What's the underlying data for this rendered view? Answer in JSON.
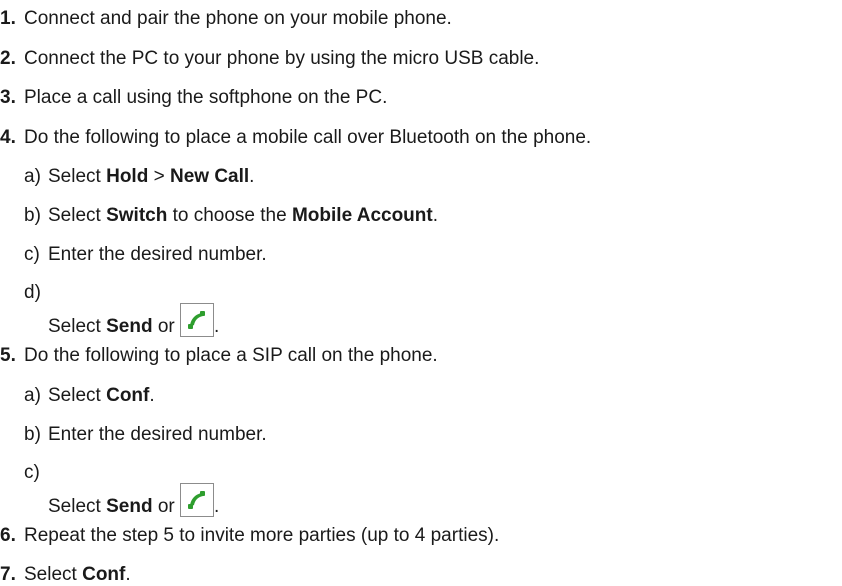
{
  "steps": [
    {
      "num": "1.",
      "text": "Connect and pair the phone on your mobile phone."
    },
    {
      "num": "2.",
      "text": "Connect the PC to your phone by using the micro USB cable."
    },
    {
      "num": "3.",
      "text": "Place a call using the softphone on the PC."
    },
    {
      "num": "4.",
      "text": "Do the following to place a mobile call over Bluetooth on the phone.",
      "substeps": {
        "a": {
          "letter": "a)",
          "pre": "Select ",
          "b1": "Hold",
          "mid": " > ",
          "b2": "New Call",
          "post": "."
        },
        "b": {
          "letter": "b)",
          "pre": "Select ",
          "b1": "Switch",
          "mid": " to choose the ",
          "b2": "Mobile Account",
          "post": "."
        },
        "c": {
          "letter": "c)",
          "text": "Enter the desired number."
        },
        "d": {
          "letter": "d)",
          "pre": "Select ",
          "b1": "Send",
          "mid": " or ",
          "post": "."
        }
      }
    },
    {
      "num": "5.",
      "text": "Do the following to place a SIP call on the phone.",
      "substeps": {
        "a": {
          "letter": "a)",
          "pre": "Select ",
          "b1": "Conf",
          "post": "."
        },
        "b": {
          "letter": "b)",
          "text": "Enter the desired number."
        },
        "c": {
          "letter": "c)",
          "pre": "Select ",
          "b1": "Send",
          "mid": " or ",
          "post": "."
        }
      }
    },
    {
      "num": "6.",
      "text": "Repeat the step 5 to invite more parties (up to 4 parties)."
    },
    {
      "num": "7.",
      "pre": "Select ",
      "b1": "Conf",
      "post": "."
    }
  ],
  "icons": {
    "send": "send-call-icon",
    "send_color": "#2e9e2e"
  }
}
